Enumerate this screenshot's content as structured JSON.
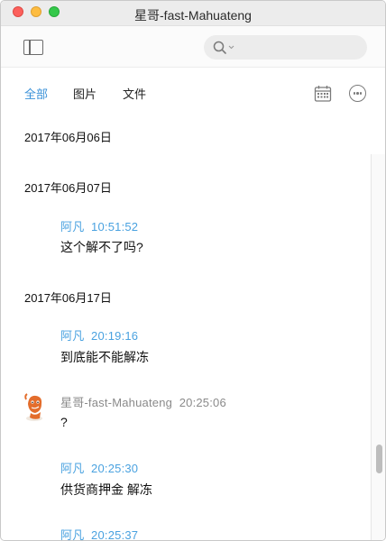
{
  "window": {
    "title": "星哥-fast-Mahuateng"
  },
  "toolbar": {
    "sidebar_icon": "sidebar-icon",
    "search_icon": "search-icon"
  },
  "tabs": [
    {
      "label": "全部",
      "active": true
    },
    {
      "label": "图片",
      "active": false
    },
    {
      "label": "文件",
      "active": false
    }
  ],
  "tab_icons": {
    "calendar": "calendar-icon",
    "more": "more-icon"
  },
  "accent_color": "#3a91d8",
  "history": {
    "date1": "2017年06月06日",
    "date2": "2017年06月07日",
    "msg1": {
      "sender": "阿凡",
      "time": "10:51:52",
      "text": "这个解不了吗?"
    },
    "date3": "2017年06月17日",
    "msg2": {
      "sender": "阿凡",
      "time": "20:19:16",
      "text": "到底能不能解冻"
    },
    "msg3": {
      "sender": "星哥-fast-Mahuateng",
      "time": "20:25:06",
      "text": "?"
    },
    "msg4": {
      "sender": "阿凡",
      "time": "20:25:30",
      "text": "供货商押金 解冻"
    },
    "msg5": {
      "sender": "阿凡",
      "time": "20:25:37"
    }
  }
}
